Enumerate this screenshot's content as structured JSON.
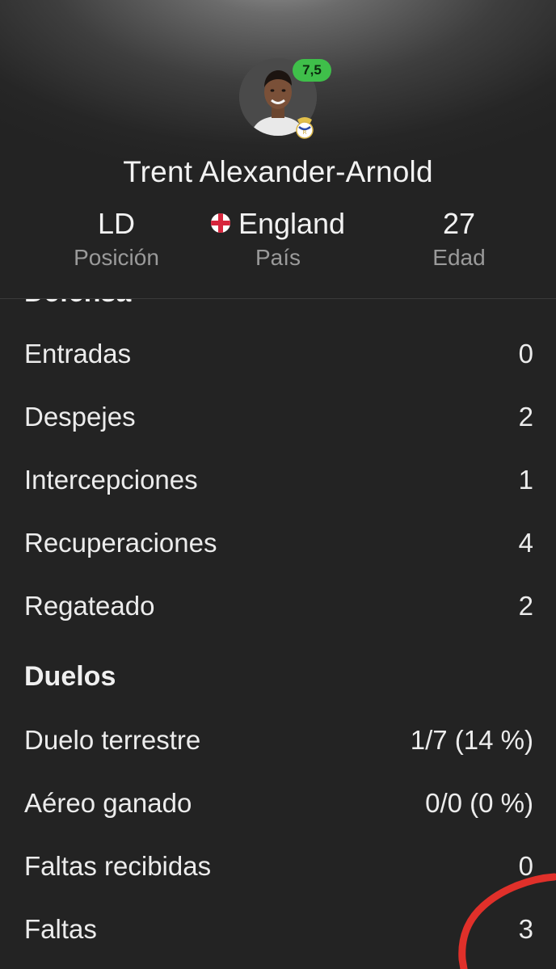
{
  "player": {
    "name": "Trent Alexander-Arnold",
    "rating": "7,5",
    "rating_color": "#3fbf4a",
    "club_icon": "real-madrid-crest-icon"
  },
  "info": {
    "position": {
      "value": "LD",
      "label": "Posición"
    },
    "country": {
      "value": "England",
      "label": "País",
      "flag_icon": "england-flag-icon"
    },
    "age": {
      "value": "27",
      "label": "Edad"
    }
  },
  "defense": {
    "title": "Defensa",
    "rows": [
      {
        "label": "Entradas",
        "value": "0"
      },
      {
        "label": "Despejes",
        "value": "2"
      },
      {
        "label": "Intercepciones",
        "value": "1"
      },
      {
        "label": "Recuperaciones",
        "value": "4"
      },
      {
        "label": "Regateado",
        "value": "2"
      }
    ]
  },
  "duels": {
    "title": "Duelos",
    "rows": [
      {
        "label": "Duelo terrestre",
        "value": "1/7 (14 %)"
      },
      {
        "label": "Aéreo ganado",
        "value": "0/0 (0 %)"
      },
      {
        "label": "Faltas recibidas",
        "value": "0"
      },
      {
        "label": "Faltas",
        "value": "3"
      }
    ]
  },
  "colors": {
    "background": "#232323",
    "annotation": "#e0302a"
  }
}
